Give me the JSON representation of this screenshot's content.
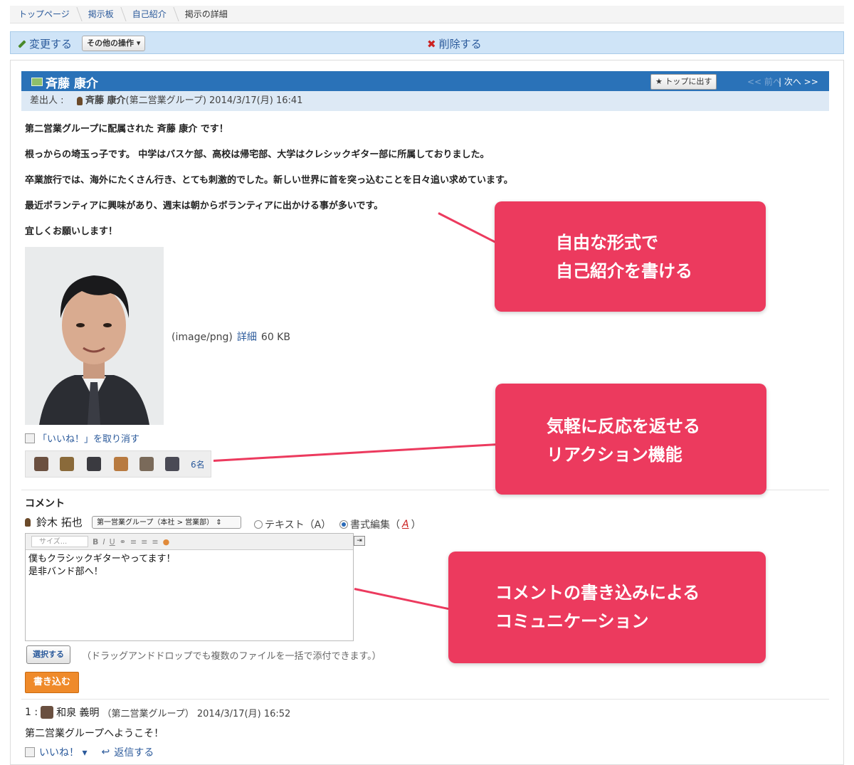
{
  "breadcrumb": [
    "トップページ",
    "掲示板",
    "自己紹介",
    "掲示の詳細"
  ],
  "toolbar": {
    "edit_label": "変更する",
    "other_ops_label": "その他の操作 ▾",
    "delete_label": "削除する"
  },
  "post": {
    "title": "斉藤 康介",
    "top_button": "トップに出す",
    "prev_label": "<< 前へ",
    "next_label": "| 次へ >>",
    "sender_label": "差出人 :",
    "sender_name": "斉藤 康介",
    "sender_meta": "(第二営業グループ) 2014/3/17(月) 16:41",
    "body": [
      "第二営業グループに配属された 斉藤 康介 です！",
      "根っからの埼玉っ子です。 中学はバスケ部、高校は帰宅部、大学はクレシックギター部に所属しておりました。",
      "卒業旅行では、海外にたくさん行き、とても刺激的でした。新しい世界に首を突っ込むことを日々追い求めています。",
      "最近ボランティアに興味があり、週末は朝からボランティアに出かける事が多いです。",
      "宜しくお願いします！"
    ],
    "attachment_type": "(image/png)",
    "attachment_detail": "詳細",
    "attachment_size": "60 KB"
  },
  "reactions": {
    "unlike_label": "「いいね！」を取り消す",
    "count": "6名"
  },
  "comment_form": {
    "heading": "コメント",
    "user": "鈴木 拓也",
    "group": "第一営業グループ（本社 > 営業部）",
    "radio_text": "テキスト（A）",
    "radio_rich": "書式編集（",
    "radio_rich_a": "A",
    "radio_rich_close": "）",
    "size_placeholder": "サイズ...",
    "content_line1": "僕もクラシックギターやってます！",
    "content_line2": "是非バンド部へ！",
    "select_button": "選択する",
    "dnd_hint": "（ドラッグアンドドロップでも複数のファイルを一括で添付できます。）",
    "post_button": "書き込む"
  },
  "reply": {
    "index": "1 :",
    "author": "和泉 義明",
    "meta": "（第二営業グループ） 2014/3/17(月) 16:52",
    "text": "第二営業グループへようこそ！",
    "like_label": "いいね！ ▾",
    "reply_label": "返信する"
  },
  "callouts": {
    "c1_line1": "自由な形式で",
    "c1_line2": "自己紹介を書ける",
    "c2_line1": "気軽に反応を返せる",
    "c2_line2": "リアクション機能",
    "c3_line1": "コメントの書き込みによる",
    "c3_line2": "コミュニケーション"
  },
  "colors": {
    "accent": "#ec3a5e",
    "title_bar": "#2a72b8",
    "toolbar": "#cfe4f7",
    "post_button": "#ef8a2a"
  }
}
